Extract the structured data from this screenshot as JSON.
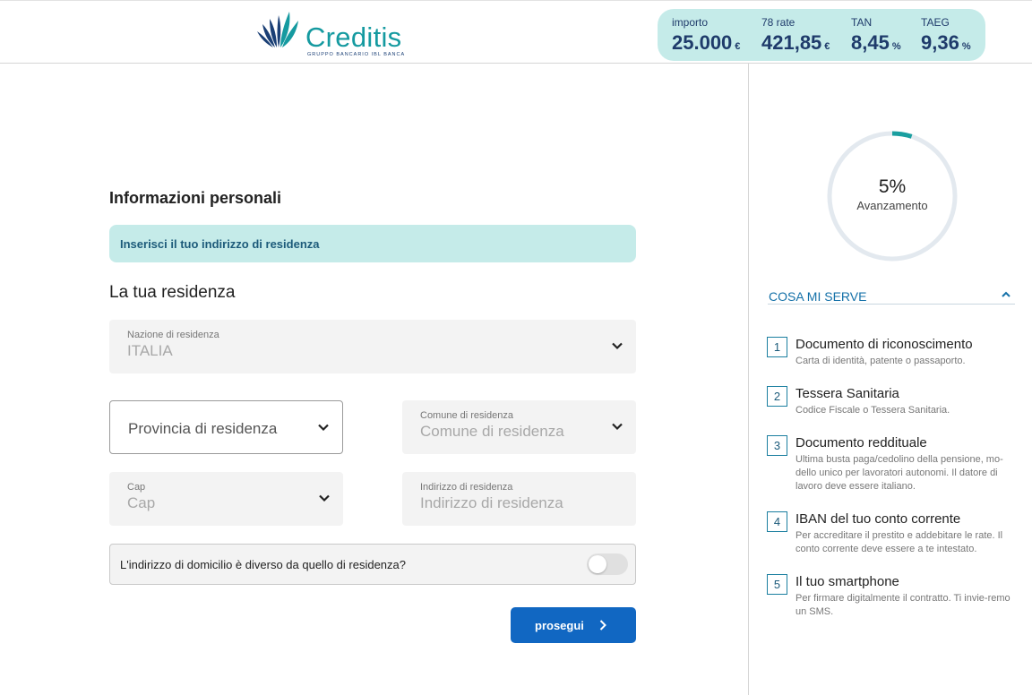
{
  "header": {
    "logo": {
      "name": "Creditis",
      "tagline": "GRUPPO BANCARIO IBL BANCA"
    },
    "summary": [
      {
        "label": "importo",
        "value": "25.000",
        "unit": "€"
      },
      {
        "label": "78 rate",
        "value": "421,85",
        "unit": "€"
      },
      {
        "label": "TAN",
        "value": "8,45",
        "unit": "%"
      },
      {
        "label": "TAEG",
        "value": "9,36",
        "unit": "%"
      }
    ]
  },
  "form": {
    "section_title": "Informazioni personali",
    "info_banner": "Inserisci il tuo indirizzo di residenza",
    "subsection_title": "La tua residenza",
    "nazione": {
      "label": "Nazione di residenza",
      "value": "ITALIA"
    },
    "provincia": {
      "placeholder": "Provincia di residenza"
    },
    "comune": {
      "label": "Comune di residenza",
      "placeholder": "Comune di residenza"
    },
    "cap": {
      "label": "Cap",
      "placeholder": "Cap"
    },
    "indirizzo": {
      "label": "Indirizzo di residenza",
      "placeholder": "Indirizzo di residenza"
    },
    "domicilio_toggle": {
      "label": "L'indirizzo di domicilio è diverso da quello di residenza?",
      "checked": false
    },
    "next_button": "prosegui"
  },
  "sidebar": {
    "progress": {
      "percent": 5,
      "percent_text": "5%",
      "label": "Avanzamento",
      "color": "#1a9fa0"
    },
    "needs_title": "COSA MI SERVE",
    "needs": [
      {
        "num": "1",
        "title": "Documento di riconoscimento",
        "desc": "Carta di identità, patente o passaporto."
      },
      {
        "num": "2",
        "title": "Tessera Sanitaria",
        "desc": "Codice Fiscale o Tessera Sanitaria."
      },
      {
        "num": "3",
        "title": "Documento reddituale",
        "desc": "Ultima busta paga/cedolino della pensione, mo-dello unico per lavoratori autonomi. Il datore di lavoro deve essere italiano."
      },
      {
        "num": "4",
        "title": "IBAN del tuo conto corrente",
        "desc": "Per accreditare il prestito e addebitare le rate. Il conto corrente deve essere a te intestato."
      },
      {
        "num": "5",
        "title": "Il tuo smartphone",
        "desc": "Per firmare digitalmente il contratto. Ti invie-remo un SMS."
      }
    ]
  },
  "colors": {
    "accent": "#159aa0",
    "primary_button": "#1167c2",
    "banner_bg": "#c5ebe9",
    "dark_text": "#1f3b6b"
  }
}
